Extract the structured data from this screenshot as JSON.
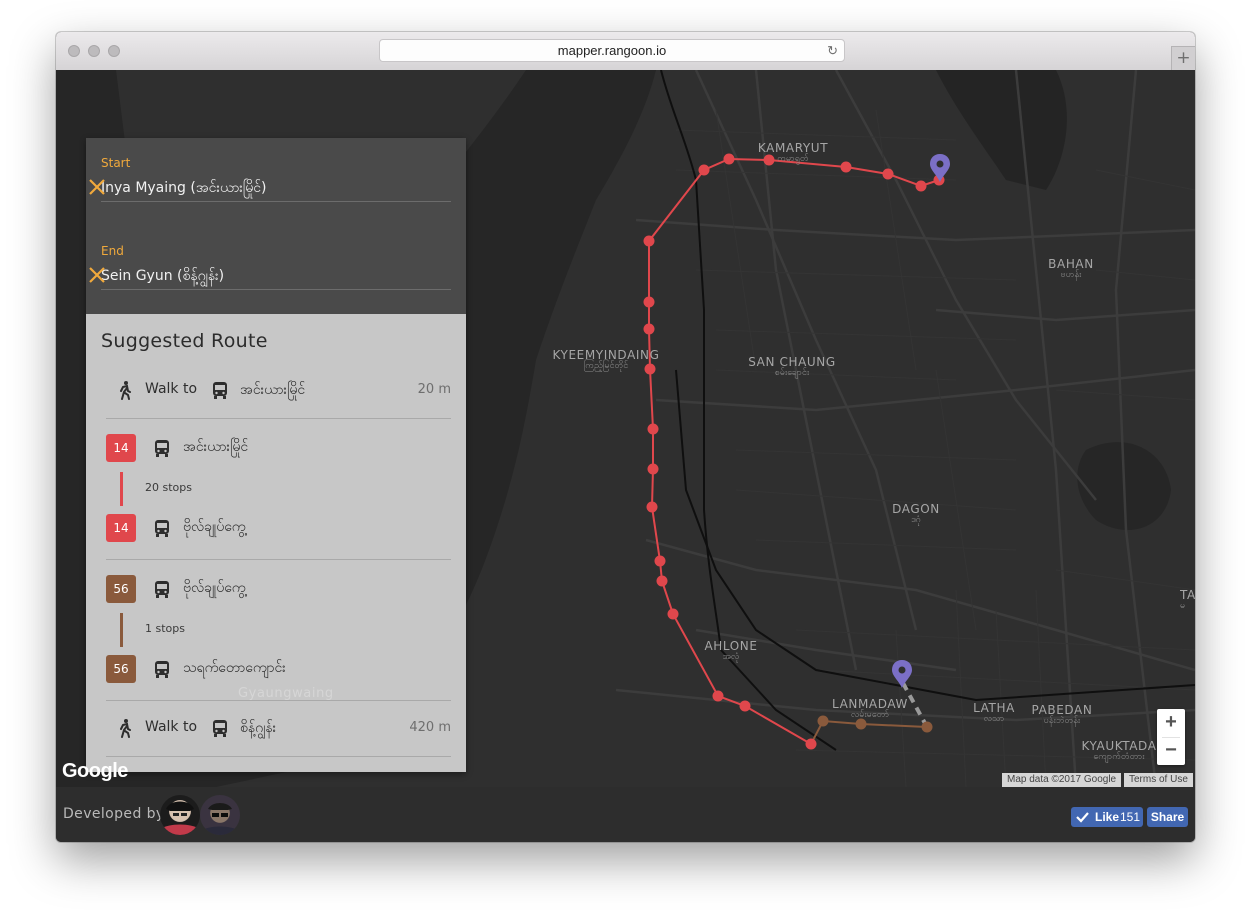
{
  "browser": {
    "url": "mapper.rangoon.io",
    "reload_icon": "↻",
    "new_tab": "+"
  },
  "search": {
    "start_label": "Start",
    "start_value": "Inya Myaing (အင်းယားမြိုင်)",
    "end_label": "End",
    "end_value": "Sein Gyun (စိန့်ဂျွန်း)"
  },
  "route": {
    "title": "Suggested Route",
    "walk1": {
      "text": "Walk to",
      "stop": "အင်းယားမြိုင်",
      "distance": "20 m"
    },
    "leg1": {
      "bus": "14",
      "color": "#e0474c",
      "from": "အင်းယားမြိုင်",
      "stops": "20 stops",
      "to": "ဗိုလ်ချုပ်ကွေ့"
    },
    "leg2": {
      "bus": "56",
      "color": "#8a5a3c",
      "from": "ဗိုလ်ချုပ်ကွေ့",
      "stops": "1 stops",
      "to": "သရက်တောကျောင်း"
    },
    "walk2": {
      "text": "Walk to",
      "stop": "စိန့်ဂျွန်း",
      "distance": "420 m"
    }
  },
  "map": {
    "labels": [
      {
        "en": "KAMARYUT",
        "mm": "ကမာရွတ်"
      },
      {
        "en": "BAHAN",
        "mm": "ဗဟန်း"
      },
      {
        "en": "KYEEMYINDAING",
        "mm": "ကြည့်မြင်တိုင်"
      },
      {
        "en": "SAN CHAUNG",
        "mm": "စမ်းချောင်း"
      },
      {
        "en": "DAGON",
        "mm": "ဒဂုံ"
      },
      {
        "en": "AHLONE",
        "mm": "အလုံ"
      },
      {
        "en": "LANMADAW",
        "mm": "လမ်းမတော်"
      },
      {
        "en": "LATHA",
        "mm": "လသာ"
      },
      {
        "en": "PABEDAN",
        "mm": "ပန်းဘဲတန်း"
      },
      {
        "en": "KYAUKTADA",
        "mm": "ကျောက်တံတား"
      },
      {
        "en": "TA",
        "mm": "မ"
      }
    ],
    "ghost_label": "Gyaungwaing",
    "google_logo": "Google",
    "attribution": "Map data ©2017 Google",
    "terms": "Terms of Use",
    "zoom_in": "+",
    "zoom_out": "−",
    "accent_red": "#e0474c",
    "accent_brown": "#8a5a3c",
    "pin_color": "#7b6fc6"
  },
  "footer": {
    "developed_by": "Developed by",
    "like_label": "Like",
    "like_count": "151",
    "share_label": "Share"
  }
}
